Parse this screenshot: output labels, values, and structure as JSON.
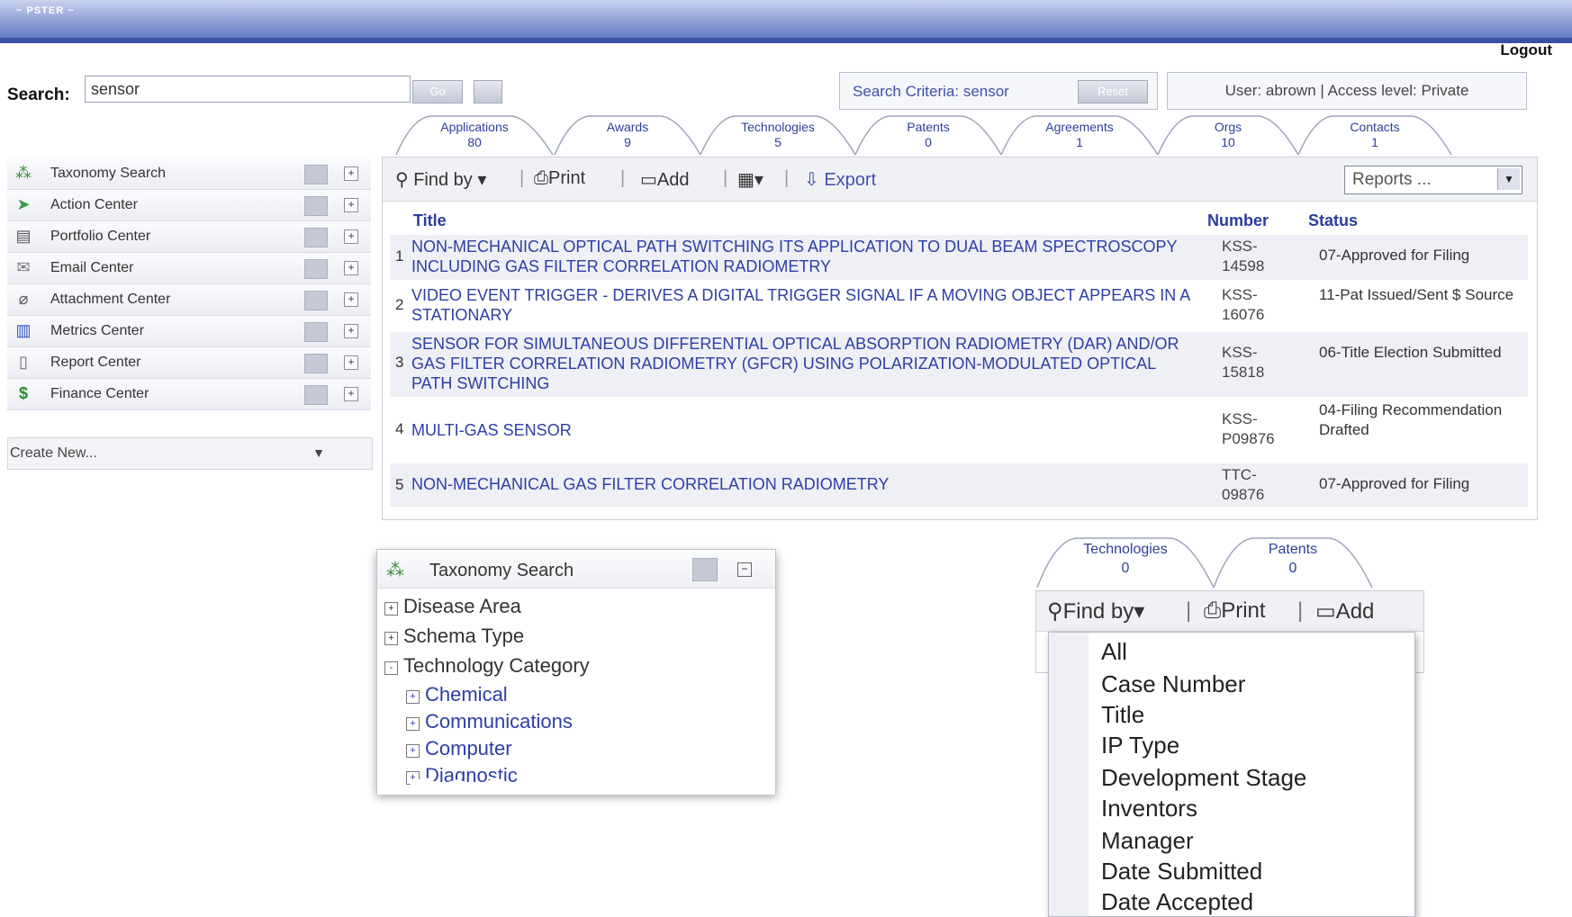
{
  "app": {
    "brand": "~ PSTER ~"
  },
  "header": {
    "logout": "Logout",
    "search_label": "Search:",
    "search_value": "sensor",
    "go_label": "Go",
    "criteria_label": "Search Criteria: sensor",
    "reset_label": "Reset",
    "user_info": "User: abrown  |  Access level: Private"
  },
  "tabs": [
    {
      "label": "Applications",
      "count": "80"
    },
    {
      "label": "Awards",
      "count": "9"
    },
    {
      "label": "Technologies",
      "count": "5"
    },
    {
      "label": "Patents",
      "count": "0"
    },
    {
      "label": "Agreements",
      "count": "1"
    },
    {
      "label": "Orgs",
      "count": "10"
    },
    {
      "label": "Contacts",
      "count": "1"
    }
  ],
  "sidebar": {
    "items": [
      {
        "label": "Taxonomy Search",
        "icon": "taxonomy-icon"
      },
      {
        "label": "Action Center",
        "icon": "action-icon"
      },
      {
        "label": "Portfolio Center",
        "icon": "portfolio-icon"
      },
      {
        "label": "Email Center",
        "icon": "email-icon"
      },
      {
        "label": "Attachment Center",
        "icon": "attachment-icon"
      },
      {
        "label": "Metrics Center",
        "icon": "metrics-icon"
      },
      {
        "label": "Report Center",
        "icon": "report-icon"
      },
      {
        "label": "Finance Center",
        "icon": "finance-icon"
      }
    ],
    "create_new": "Create New..."
  },
  "toolbar": {
    "find_by": "Find by",
    "print": "Print",
    "add": "Add",
    "export": "Export",
    "reports": "Reports ..."
  },
  "table": {
    "headers": {
      "title": "Title",
      "number": "Number",
      "status": "Status"
    },
    "rows": [
      {
        "num": "1",
        "title": "NON-MECHANICAL OPTICAL PATH SWITCHING ITS APPLICATION TO DUAL BEAM SPECTROSCOPY INCLUDING GAS FILTER CORRELATION RADIOMETRY",
        "number": "KSS-14598",
        "status": "07-Approved for Filing"
      },
      {
        "num": "2",
        "title": "VIDEO EVENT TRIGGER - DERIVES A DIGITAL TRIGGER SIGNAL IF A MOVING OBJECT APPEARS IN A STATIONARY",
        "number": "KSS-16076",
        "status": "11-Pat Issued/Sent $ Source"
      },
      {
        "num": "3",
        "title": "SENSOR FOR SIMULTANEOUS DIFFERENTIAL OPTICAL ABSORPTION RADIOMETRY (DAR) AND/OR GAS FILTER CORRELATION RADIOMETRY (GFCR) USING POLARIZATION-MODULATED OPTICAL PATH SWITCHING",
        "number": "KSS-15818",
        "status": "06-Title Election Submitted"
      },
      {
        "num": "4",
        "title": "MULTI-GAS SENSOR",
        "number": "KSS-P09876",
        "status": "04-Filing Recommendation Drafted"
      },
      {
        "num": "5",
        "title": "NON-MECHANICAL GAS FILTER CORRELATION RADIOMETRY",
        "number": "TTC-09876",
        "status": "07-Approved for Filing"
      }
    ]
  },
  "taxonomy_popup": {
    "title": "Taxonomy Search",
    "nodes": [
      {
        "label": "Disease Area",
        "state": "+"
      },
      {
        "label": "Schema Type",
        "state": "+"
      },
      {
        "label": "Technology Category",
        "state": "-"
      }
    ],
    "children": [
      {
        "label": "Chemical",
        "state": "+"
      },
      {
        "label": "Communications",
        "state": "+"
      },
      {
        "label": "Computer",
        "state": "+"
      },
      {
        "label": "Diagnostic",
        "state": "+"
      }
    ]
  },
  "panel2": {
    "tabs": [
      {
        "label": "Technologies",
        "count": "0"
      },
      {
        "label": "Patents",
        "count": "0"
      }
    ],
    "find_by": "Find by",
    "print": "Print",
    "add": "Add"
  },
  "findby_menu": {
    "items": [
      "All",
      "Case Number",
      "Title",
      "IP Type",
      "Development Stage",
      "Inventors",
      "Manager",
      "Date Submitted",
      "Date Accepted"
    ]
  }
}
